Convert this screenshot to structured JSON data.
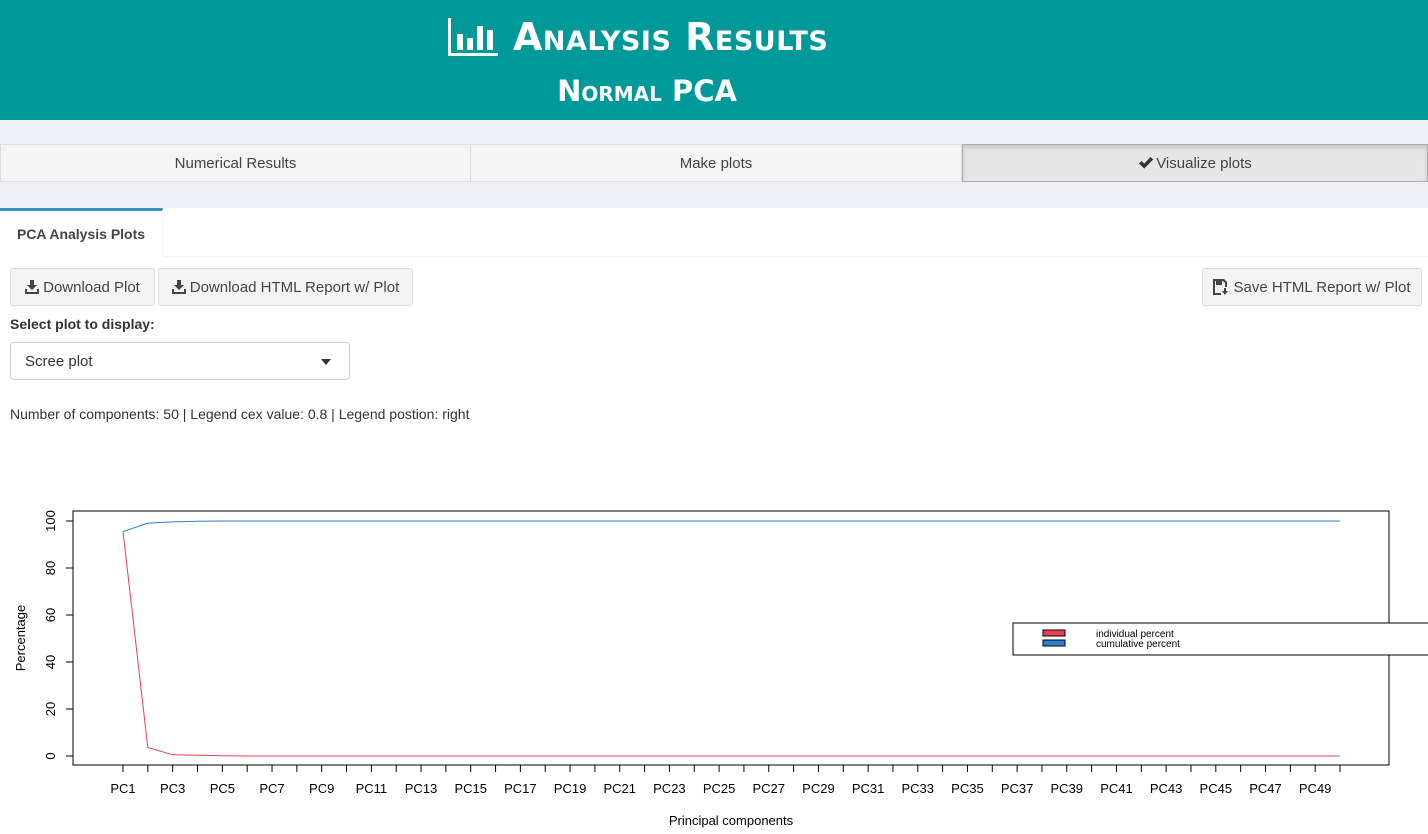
{
  "header": {
    "title": "Analysis Results",
    "subtitle": "Normal PCA",
    "icon": "bar-chart-icon",
    "bg_color": "#009999"
  },
  "main_tabs": [
    {
      "label": "Numerical Results",
      "active": false
    },
    {
      "label": "Make plots",
      "active": false
    },
    {
      "label": "Visualize plots",
      "active": true,
      "icon": "check-icon"
    }
  ],
  "sub_tab": {
    "label": "PCA Analysis Plots"
  },
  "buttons": {
    "download_plot": "Download Plot",
    "download_html": "Download HTML Report w/ Plot",
    "save_html": "Save HTML Report w/ Plot"
  },
  "select": {
    "label": "Select plot to display:",
    "value": "Scree plot"
  },
  "info": {
    "line": "Number of components: 50 | Legend cex value: 0.8 | Legend postion: right"
  },
  "chart_data": {
    "type": "line",
    "xlabel": "Principal components",
    "ylabel": "Percentage",
    "ylim": [
      0,
      100
    ],
    "yticks": [
      0,
      20,
      40,
      60,
      80,
      100
    ],
    "x_count": 50,
    "tick_labels": [
      "PC1",
      "PC3",
      "PC5",
      "PC7",
      "PC9",
      "PC11",
      "PC13",
      "PC15",
      "PC17",
      "PC19",
      "PC21",
      "PC23",
      "PC25",
      "PC27",
      "PC29",
      "PC31",
      "PC33",
      "PC35",
      "PC37",
      "PC39",
      "PC41",
      "PC43",
      "PC45",
      "PC47",
      "PC49"
    ],
    "legend_position": "right",
    "series": [
      {
        "name": "individual percent",
        "color": "#e8404f",
        "values": [
          95.5,
          3.6,
          0.5,
          0.3,
          0.1,
          0,
          0,
          0,
          0,
          0,
          0,
          0,
          0,
          0,
          0,
          0,
          0,
          0,
          0,
          0,
          0,
          0,
          0,
          0,
          0,
          0,
          0,
          0,
          0,
          0,
          0,
          0,
          0,
          0,
          0,
          0,
          0,
          0,
          0,
          0,
          0,
          0,
          0,
          0,
          0,
          0,
          0,
          0,
          0,
          0
        ]
      },
      {
        "name": "cumulative percent",
        "color": "#2a7fd4",
        "values": [
          95.5,
          99.1,
          99.6,
          99.9,
          100,
          100,
          100,
          100,
          100,
          100,
          100,
          100,
          100,
          100,
          100,
          100,
          100,
          100,
          100,
          100,
          100,
          100,
          100,
          100,
          100,
          100,
          100,
          100,
          100,
          100,
          100,
          100,
          100,
          100,
          100,
          100,
          100,
          100,
          100,
          100,
          100,
          100,
          100,
          100,
          100,
          100,
          100,
          100,
          100,
          100
        ]
      }
    ]
  }
}
